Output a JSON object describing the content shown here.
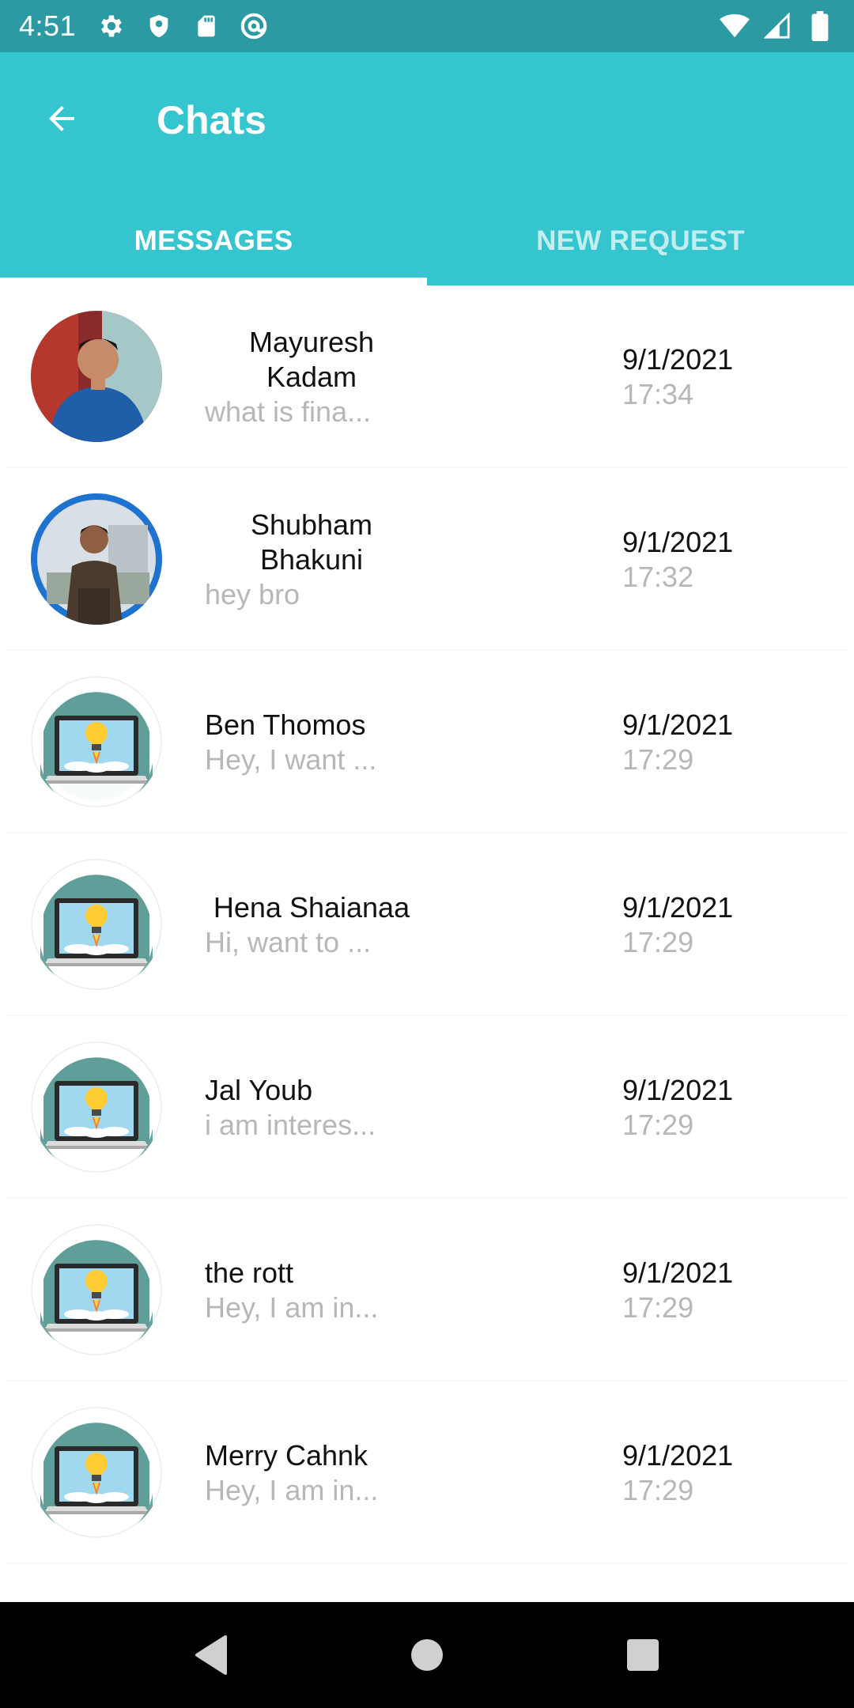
{
  "status_bar": {
    "time": "4:51",
    "icons": [
      "gear-icon",
      "shield-icon",
      "sd-card-icon",
      "at-sign-icon",
      "wifi-icon",
      "signal-icon",
      "battery-icon"
    ]
  },
  "app_bar": {
    "title": "Chats",
    "back_icon": "arrow-left-icon",
    "background": "#35c5ce"
  },
  "tabs": [
    {
      "label": "MESSAGES",
      "active": true
    },
    {
      "label": "NEW REQUEST",
      "active": false
    }
  ],
  "chats": [
    {
      "name": "Mayuresh Kadam",
      "preview": "what is fina...",
      "date": "9/1/2021",
      "time": "17:34",
      "avatar": "photo-man-blue-shirt"
    },
    {
      "name": "Shubham Bhakuni",
      "preview": "hey bro",
      "date": "9/1/2021",
      "time": "17:32",
      "avatar": "photo-man-jacket"
    },
    {
      "name": "Ben Thomos",
      "preview": "Hey, I want ...",
      "date": "9/1/2021",
      "time": "17:29",
      "avatar": "startup-laptop-icon"
    },
    {
      "name": "Hena Shaianaa",
      "preview": "Hi, want to ...",
      "date": "9/1/2021",
      "time": "17:29",
      "avatar": "startup-laptop-icon"
    },
    {
      "name": "Jal Youb",
      "preview": "i am interes...",
      "date": "9/1/2021",
      "time": "17:29",
      "avatar": "startup-laptop-icon"
    },
    {
      "name": "the rott",
      "preview": "Hey, I am in...",
      "date": "9/1/2021",
      "time": "17:29",
      "avatar": "startup-laptop-icon"
    },
    {
      "name": "Merry Cahnk",
      "preview": "Hey, I am in...",
      "date": "9/1/2021",
      "time": "17:29",
      "avatar": "startup-laptop-icon"
    }
  ],
  "nav_bar": {
    "buttons": [
      "back-triangle-icon",
      "home-circle-icon",
      "recents-square-icon"
    ]
  },
  "colors": {
    "accent": "#35c5ce",
    "status_bar": "#2b9aa3",
    "muted_text": "#b7b7b7"
  }
}
